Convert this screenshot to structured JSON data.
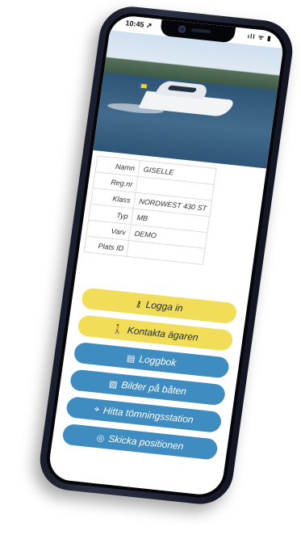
{
  "status_bar": {
    "time": "10:45 ↗",
    "indicators": "ıll ᯤ ▮"
  },
  "boat": {
    "photo_icon": "motor-yacht-photo",
    "fields": [
      {
        "label": "Namn",
        "value": "GISELLE"
      },
      {
        "label": "Reg.nr",
        "value": ""
      },
      {
        "label": "Klass",
        "value": "NORDWEST 430 ST"
      },
      {
        "label": "Typ",
        "value": "MB"
      },
      {
        "label": "Varv",
        "value": "DEMO"
      },
      {
        "label": "Plats ID",
        "value": ""
      }
    ]
  },
  "actions": {
    "login": {
      "label": "Logga in",
      "icon": "key-icon",
      "glyph": "⚷"
    },
    "contact_owner": {
      "label": "Kontakta ägaren",
      "icon": "person-walking-icon",
      "glyph": "🚶"
    },
    "logbook": {
      "label": "Loggbok",
      "icon": "book-icon",
      "glyph": "▤"
    },
    "photos": {
      "label": "Bilder på båten",
      "icon": "image-icon",
      "glyph": "▨"
    },
    "pumpout": {
      "label": "Hitta tömningsstation",
      "icon": "map-pin-icon",
      "glyph": "⌖"
    },
    "send_position": {
      "label": "Skicka positionen",
      "icon": "target-icon",
      "glyph": "◎"
    }
  },
  "colors": {
    "primary": "#3f8cc0",
    "accent": "#f2dd58",
    "text_dark": "#1f2a35"
  }
}
